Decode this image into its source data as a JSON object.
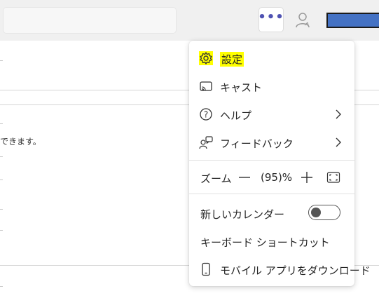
{
  "header": {
    "more_button_label": "•••",
    "icons": [
      "more-icon",
      "person-icon"
    ]
  },
  "background": {
    "partial_text": "できます。"
  },
  "menu": {
    "items": [
      {
        "label": "設定",
        "icon": "gear-icon",
        "highlighted": true
      },
      {
        "label": "キャスト",
        "icon": "cast-icon"
      },
      {
        "label": "ヘルプ",
        "icon": "help-icon",
        "submenu": true
      },
      {
        "label": "フィードバック",
        "icon": "feedback-icon",
        "submenu": true
      }
    ],
    "zoom": {
      "label": "ズーム",
      "minus": "—",
      "value": "(95)%",
      "plus": "+"
    },
    "new_calendar": {
      "label": "新しいカレンダー",
      "toggle_on": false
    },
    "shortcuts": {
      "label": "キーボード ショートカット"
    },
    "mobile": {
      "label": "モバイル アプリをダウンロード",
      "icon": "phone-icon"
    }
  },
  "colors": {
    "accent": "#4f52b2",
    "highlight": "#ffff00",
    "brand_bar": "#4472c4"
  }
}
